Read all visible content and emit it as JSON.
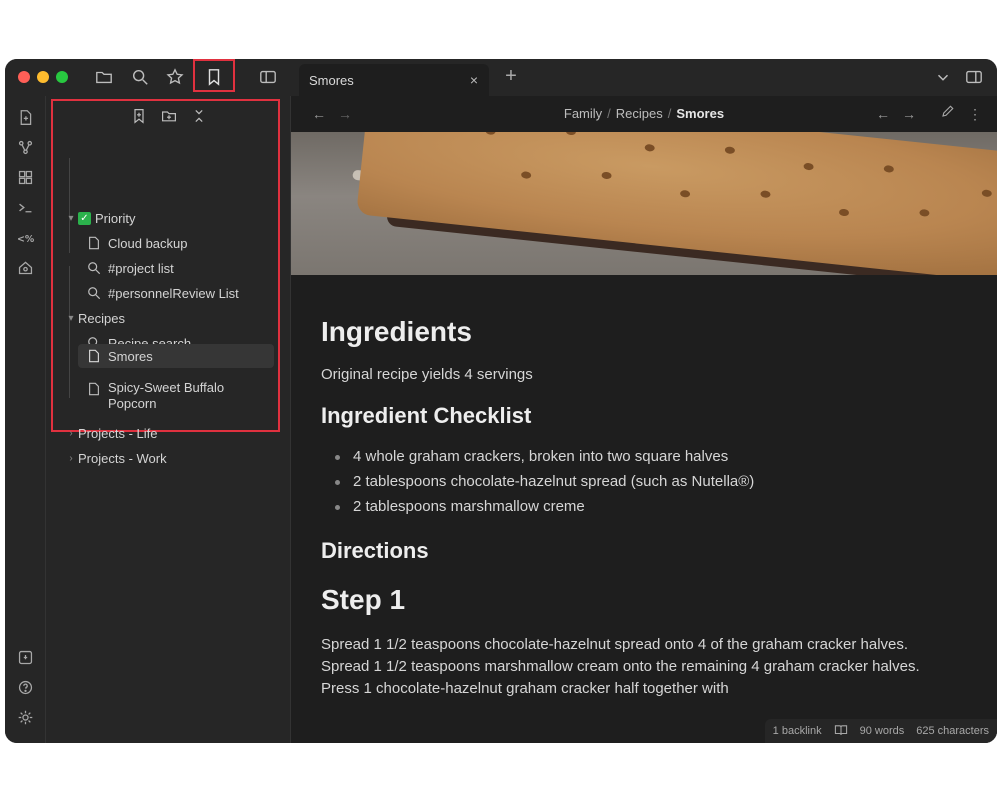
{
  "tab": {
    "title": "Smores",
    "close": "×",
    "new": "+"
  },
  "breadcrumb": {
    "parts": [
      "Family",
      "Recipes",
      "Smores"
    ],
    "sep": "/"
  },
  "sidebar": {
    "tree": [
      {
        "label": "Priority",
        "check": "✓"
      },
      {
        "label": "Cloud backup"
      },
      {
        "label": "#project list"
      },
      {
        "label": "#personnelReview List"
      },
      {
        "label": "Recipes"
      },
      {
        "label": "Recipe search"
      },
      {
        "label": "Smores"
      },
      {
        "label": "Spicy-Sweet Buffalo",
        "label2": "Popcorn"
      },
      {
        "label": "Projects - Life"
      },
      {
        "label": "Projects - Work"
      }
    ]
  },
  "doc": {
    "h_ingredients": "Ingredients",
    "yield": "Original recipe yields 4 servings",
    "h_checklist": "Ingredient Checklist",
    "items": [
      "4 whole graham crackers, broken into two square halves",
      "2 tablespoons chocolate-hazelnut spread (such as Nutella®)",
      "2 tablespoons marshmallow creme"
    ],
    "h_directions": "Directions",
    "h_step1": "Step 1",
    "steps": [
      "Spread 1 1/2 teaspoons chocolate-hazelnut spread onto 4 of the graham cracker halves.",
      "Spread 1 1/2 teaspoons marshmallow cream onto the remaining 4 graham cracker halves.",
      "Press 1 chocolate-hazelnut graham cracker half together with"
    ]
  },
  "status": {
    "backlinks": "1 backlink",
    "words": "90 words",
    "chars": "625 characters"
  },
  "colors": {
    "highlight": "#e0313f",
    "check": "#2bb24c"
  }
}
